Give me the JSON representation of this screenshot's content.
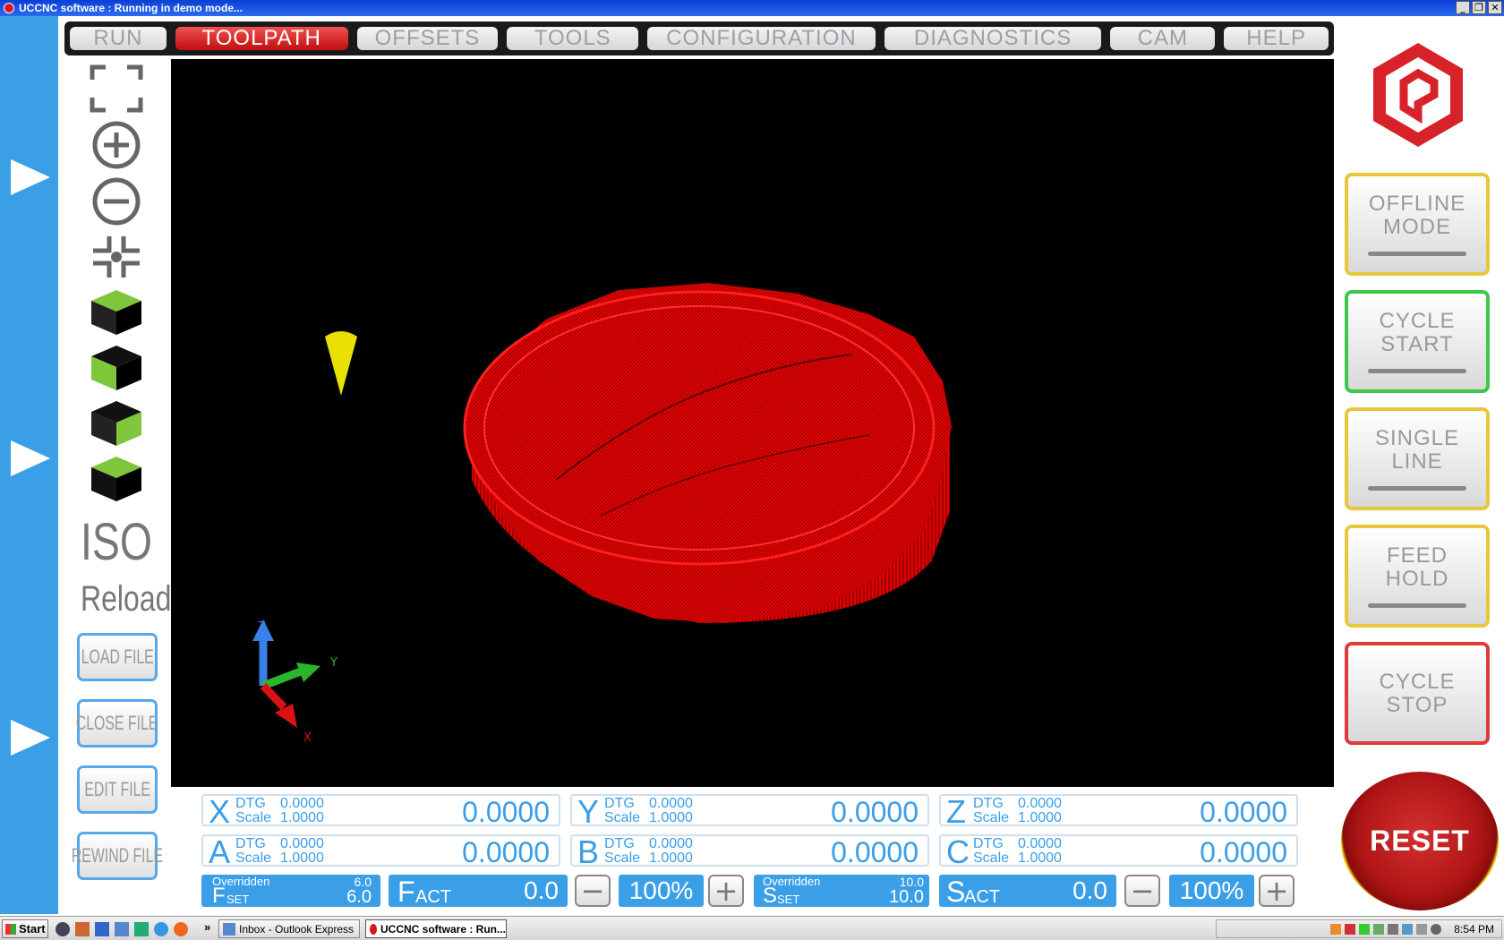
{
  "window": {
    "title": "UCCNC software : Running in demo mode...",
    "controls": [
      "_",
      "❐",
      "✕"
    ]
  },
  "tabs": [
    {
      "label": "RUN",
      "active": false
    },
    {
      "label": "TOOLPATH",
      "active": true
    },
    {
      "label": "OFFSETS",
      "active": false
    },
    {
      "label": "TOOLS",
      "active": false
    },
    {
      "label": "CONFIGURATION",
      "active": false
    },
    {
      "label": "DIAGNOSTICS",
      "active": false
    },
    {
      "label": "CAM",
      "active": false
    },
    {
      "label": "HELP",
      "active": false
    }
  ],
  "view_tools": {
    "icons": [
      "fit-view-icon",
      "zoom-in-icon",
      "zoom-out-icon",
      "center-view-icon",
      "top-view-icon",
      "front-view-icon",
      "side-view-icon",
      "bottom-view-icon"
    ],
    "iso_label": "ISO",
    "reload_label": "Reload"
  },
  "file_buttons": {
    "load": "LOAD FILE",
    "close": "CLOSE FILE",
    "edit": "EDIT FILE",
    "rewind": "REWIND FILE"
  },
  "viewport": {
    "axis_labels": {
      "z": "Z",
      "y": "Y",
      "x": "X"
    }
  },
  "right_panel": {
    "offline_mode": [
      "OFFLINE",
      "MODE"
    ],
    "cycle_start": [
      "CYCLE",
      "START"
    ],
    "single_line": [
      "SINGLE",
      "LINE"
    ],
    "feed_hold": [
      "FEED",
      "HOLD"
    ],
    "cycle_stop": [
      "CYCLE",
      "STOP"
    ],
    "reset": "RESET",
    "colors": {
      "offline_border": "#e6c83a",
      "start_border": "#3cc84a",
      "single_border": "#e6c83a",
      "feed_border": "#e6c83a",
      "stop_border": "#e03a3a"
    }
  },
  "dro": {
    "dtg_label": "DTG",
    "scale_label": "Scale",
    "axes": [
      {
        "axis": "X",
        "dtg": "0.0000",
        "scale": "1.0000",
        "value": "0.0000"
      },
      {
        "axis": "Y",
        "dtg": "0.0000",
        "scale": "1.0000",
        "value": "0.0000"
      },
      {
        "axis": "Z",
        "dtg": "0.0000",
        "scale": "1.0000",
        "value": "0.0000"
      },
      {
        "axis": "A",
        "dtg": "0.0000",
        "scale": "1.0000",
        "value": "0.0000"
      },
      {
        "axis": "B",
        "dtg": "0.0000",
        "scale": "1.0000",
        "value": "0.0000"
      },
      {
        "axis": "C",
        "dtg": "0.0000",
        "scale": "1.0000",
        "value": "0.0000"
      }
    ]
  },
  "feed": {
    "overridden_label": "Overridden",
    "fset_label": "F",
    "fset_sub": "SET",
    "fset_over": "6.0",
    "fset_value": "6.0",
    "fact_label": "F",
    "fact_sub": "ACT",
    "fact_value": "0.0",
    "override_pct": "100%"
  },
  "spindle": {
    "overridden_label": "Overridden",
    "sset_label": "S",
    "sset_sub": "SET",
    "sset_over": "10.0",
    "sset_value": "10.0",
    "sact_label": "S",
    "sact_sub": "ACT",
    "sact_value": "0.0",
    "override_pct": "100%"
  },
  "taskbar": {
    "start": "Start",
    "chevron": "»",
    "tasks": [
      {
        "label": "Inbox - Outlook Express",
        "active": false
      },
      {
        "label": "UCCNC software : Run...",
        "active": true
      }
    ],
    "clock": "8:54 PM"
  }
}
